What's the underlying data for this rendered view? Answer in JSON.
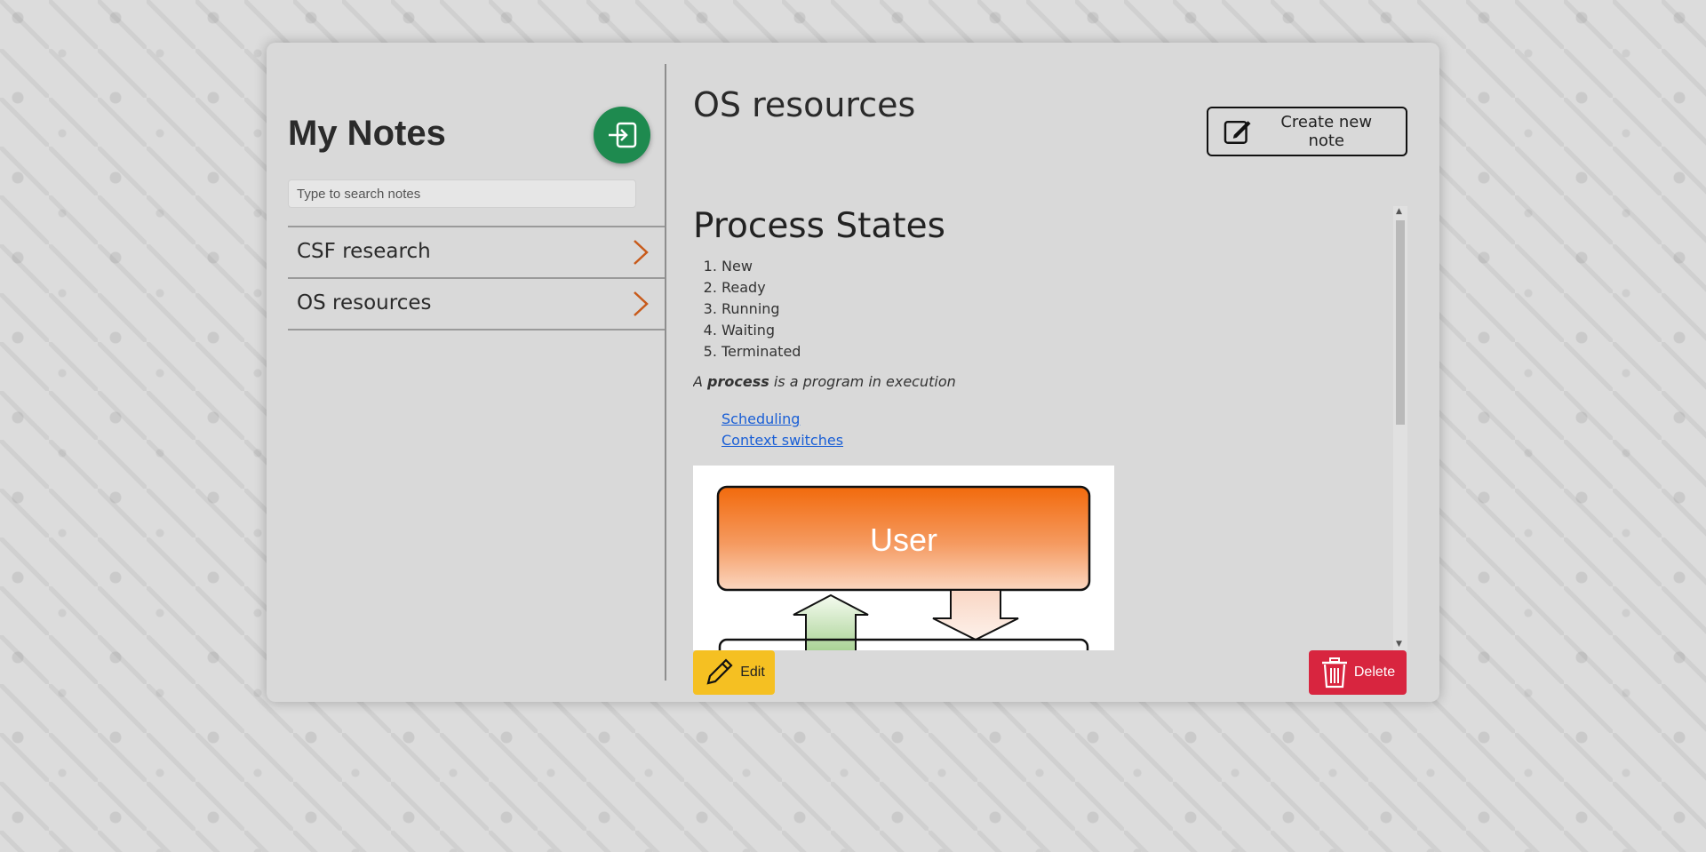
{
  "sidebar": {
    "title": "My Notes",
    "logout_icon": "logout-icon",
    "search": {
      "placeholder": "Type to search notes",
      "value": ""
    },
    "notes": [
      {
        "label": "CSF research",
        "icon": "chevron-right-icon"
      },
      {
        "label": "OS resources",
        "icon": "chevron-right-icon"
      }
    ]
  },
  "note": {
    "title": "OS resources",
    "create_label": "Create new note",
    "create_icon": "edit-square-icon",
    "content": {
      "heading": "Process States",
      "states": [
        "New",
        "Ready",
        "Running",
        "Waiting",
        "Terminated"
      ],
      "definition_prefix": "A ",
      "definition_bold": "process",
      "definition_suffix": " is a program in execution",
      "links": [
        "Scheduling",
        "Context switches"
      ],
      "diagram_label": "User"
    },
    "edit_label": "Edit",
    "delete_label": "Delete"
  },
  "colors": {
    "logout": "#1e8a4f",
    "edit": "#f5c022",
    "delete": "#d8253f",
    "chevron": "#c85a1a",
    "link": "#1a5fd6",
    "diagram_orange": "#f26a0c"
  }
}
